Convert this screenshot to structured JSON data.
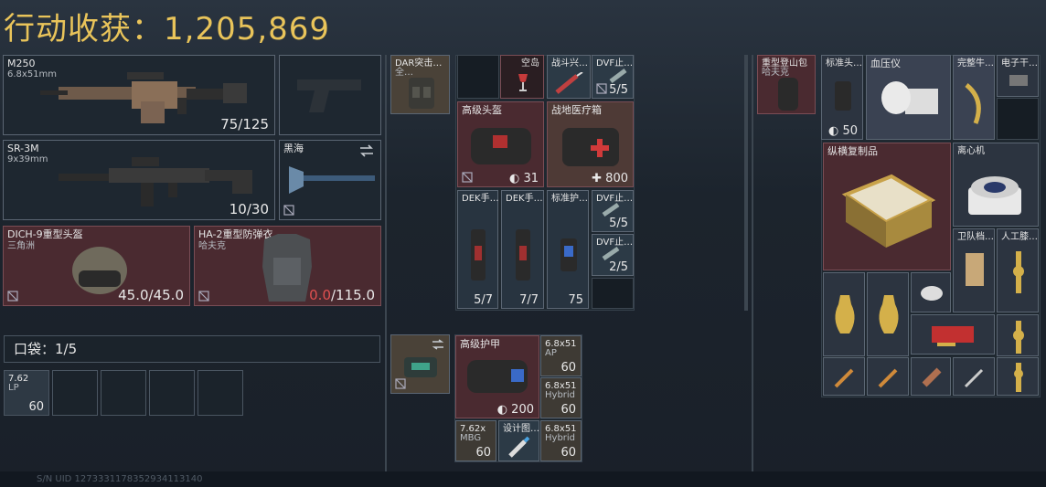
{
  "header": {
    "title": "行动收获：1,205,869"
  },
  "loadout": {
    "primary": {
      "name": "M250",
      "caliber": "6.8x51mm",
      "ammo": "75/125"
    },
    "secondary": {
      "name": "SR-3M",
      "caliber": "9x39mm",
      "ammo": "10/30"
    },
    "melee": {
      "name": "黑海"
    },
    "helmet": {
      "name": "DICH-9重型头盔",
      "sub": "三角洲",
      "durability": "45.0/45.0"
    },
    "armor": {
      "name": "HA-2重型防弹衣",
      "sub": "哈夫克",
      "durability_current": "0.0",
      "durability_max": "/115.0"
    }
  },
  "pocket": {
    "label": "口袋：1/5",
    "items": [
      {
        "name": "7.62",
        "sub": "LP",
        "count": "60"
      }
    ]
  },
  "chest_rig": {
    "name": "DAR突击…",
    "sub": "全…",
    "items": [
      {
        "name": "空岛",
        "count": ""
      },
      {
        "name": "战斗兴…",
        "count": ""
      },
      {
        "name": "DVF止…",
        "count": "5/5"
      },
      {
        "name": "高级头盔",
        "count": "31"
      },
      {
        "name": "战地医疗箱",
        "count": "800"
      },
      {
        "name": "DEK手…",
        "count": "5/7"
      },
      {
        "name": "DEK手…",
        "count": "7/7"
      },
      {
        "name": "标准护…",
        "count": "75"
      },
      {
        "name": "DVF止…",
        "count": "5/5"
      },
      {
        "name": "DVF止…",
        "count": "2/5"
      }
    ]
  },
  "backpack": {
    "items": [
      {
        "name": "高级护甲",
        "count": "200"
      },
      {
        "name": "6.8x51",
        "sub": "AP",
        "count": "60"
      },
      {
        "name": "6.8x51",
        "sub": "Hybrid",
        "count": "60"
      },
      {
        "name": "7.62x",
        "sub": "MBG",
        "count": "60"
      },
      {
        "name": "设计图…",
        "count": ""
      },
      {
        "name": "6.8x51",
        "sub": "Hybrid",
        "count": "60"
      }
    ]
  },
  "container": {
    "name": "重型登山包",
    "sub": "哈夫克",
    "items": [
      {
        "name": "标准头…",
        "count": "50"
      },
      {
        "name": "血压仪"
      },
      {
        "name": "完整牛…"
      },
      {
        "name": "电子干…"
      },
      {
        "name": "纵横复制品"
      },
      {
        "name": "离心机"
      },
      {
        "name": "卫队档…"
      },
      {
        "name": "人工膝…"
      }
    ]
  },
  "footer": {
    "text": "S/N UID 1273331178352934113140"
  }
}
